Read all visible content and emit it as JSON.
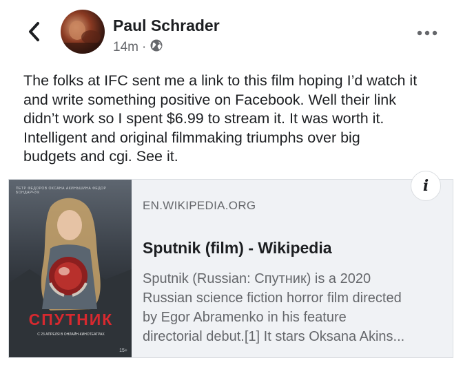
{
  "header": {
    "author": "Paul Schrader",
    "time": "14m",
    "separator": "·",
    "back_icon": "chevron-left-icon",
    "privacy_icon": "globe-icon",
    "more_icon": "more-horizontal-icon"
  },
  "post": {
    "text": "The folks at IFC sent me a link to this film hoping I’d watch it\nand write something positive on Facebook. Well their link\ndidn’t work so I spent $6.99 to stream it. It was worth it.\nIntelligent and original filmmaking triumphs over big\nbudgets and cgi.  See it."
  },
  "link": {
    "domain": "EN.WIKIPEDIA.ORG",
    "title": "Sputnik (film) - Wikipedia",
    "description": "Sputnik (Russian: Спутник) is a 2020\nRussian science fiction horror film directed\nby Egor Abramenko in his feature\ndirectorial debut.[1] It stars Oksana Akins...",
    "info_icon": "i"
  },
  "poster": {
    "title": "СПУТНИК",
    "top_names": "ПЕТР ФЕДОРОВ   ОКСАНА АКИНЬШИНА   ФЕДОР БОНДАРЧУК",
    "release_line": "С 23 АПРЕЛЯ В ОНЛАЙН-КИНОТЕАТРАХ",
    "age_rating": "15+"
  },
  "colors": {
    "text_primary": "#1c1e21",
    "text_secondary": "#65676b",
    "card_background": "#f0f2f5",
    "card_border": "#dadde1",
    "poster_title": "#d7292f"
  }
}
